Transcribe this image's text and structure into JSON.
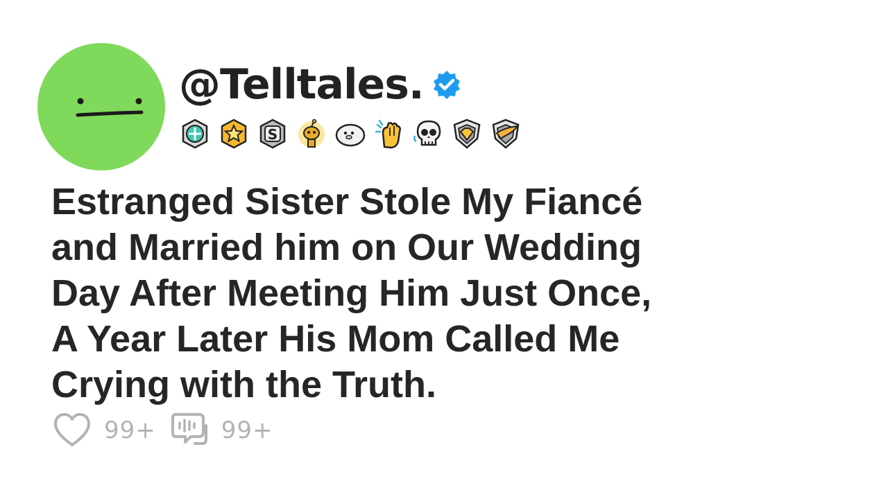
{
  "profile": {
    "handle": "@Telltales.",
    "verified": true,
    "avatar_color": "#7fd95a",
    "verified_color": "#1d9bf0"
  },
  "badges": [
    {
      "name": "helpful-badge-icon"
    },
    {
      "name": "gold-star-badge-icon"
    },
    {
      "name": "silver-s-badge-icon"
    },
    {
      "name": "gold-snoo-award-icon"
    },
    {
      "name": "seal-award-icon"
    },
    {
      "name": "clapping-hands-award-icon"
    },
    {
      "name": "skull-award-icon"
    },
    {
      "name": "gold-gem-shield-icon"
    },
    {
      "name": "gold-wing-shield-icon"
    }
  ],
  "post": {
    "title_lines": [
      "Estranged Sister Stole My Fiancé",
      "and Married him on Our Wedding",
      "Day After Meeting Him Just Once,",
      "A Year Later His Mom Called Me",
      "Crying with the Truth."
    ]
  },
  "stats": {
    "likes": "99+",
    "comments": "99+"
  }
}
